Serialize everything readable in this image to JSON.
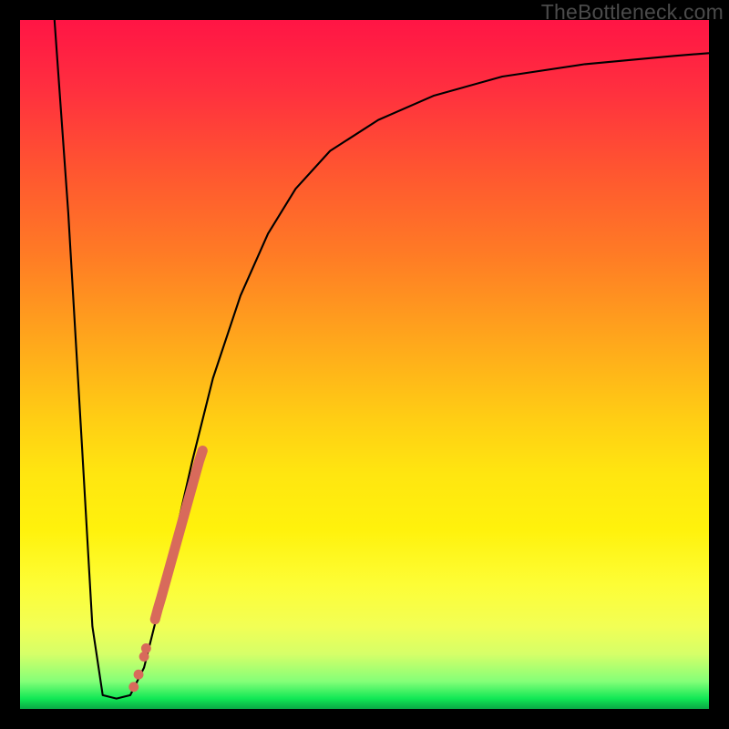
{
  "watermark": "TheBottleneck.com",
  "chart_data": {
    "type": "line",
    "title": "",
    "xlabel": "",
    "ylabel": "",
    "xlim": [
      0,
      100
    ],
    "ylim": [
      0,
      100
    ],
    "grid": false,
    "legend": false,
    "series": [
      {
        "name": "bottleneck-curve",
        "x": [
          5,
          7,
          9,
          10.5,
          12,
          14,
          16,
          18,
          20,
          22.5,
          25,
          28,
          32,
          36,
          40,
          45,
          52,
          60,
          70,
          82,
          95,
          100
        ],
        "y": [
          100,
          72,
          38,
          12,
          2,
          1.5,
          2,
          6,
          14,
          25,
          36,
          48,
          60,
          69,
          75.5,
          81,
          85.5,
          89,
          91.8,
          93.6,
          94.8,
          95.2
        ]
      }
    ],
    "markers": {
      "name": "highlight-segment",
      "color": "#d86a5b",
      "points": [
        {
          "x": 16.5,
          "y": 3.2
        },
        {
          "x": 17.2,
          "y": 5.0
        },
        {
          "x": 18.0,
          "y": 7.6
        },
        {
          "x": 18.3,
          "y": 8.8
        },
        {
          "x": 19.6,
          "y": 13.0
        },
        {
          "x": 20.0,
          "y": 14.5
        },
        {
          "x": 20.5,
          "y": 16.2
        },
        {
          "x": 21.0,
          "y": 18.0
        },
        {
          "x": 21.5,
          "y": 19.8
        },
        {
          "x": 22.0,
          "y": 21.6
        },
        {
          "x": 22.5,
          "y": 23.4
        },
        {
          "x": 23.0,
          "y": 25.2
        },
        {
          "x": 23.5,
          "y": 27.0
        },
        {
          "x": 24.0,
          "y": 28.8
        },
        {
          "x": 24.5,
          "y": 30.6
        },
        {
          "x": 25.0,
          "y": 32.4
        },
        {
          "x": 25.5,
          "y": 34.2
        },
        {
          "x": 26.0,
          "y": 36.0
        },
        {
          "x": 26.5,
          "y": 37.5
        }
      ]
    }
  }
}
